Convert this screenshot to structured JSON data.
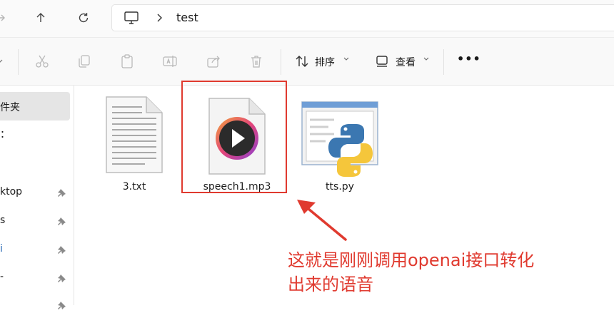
{
  "nav": {
    "forward_icon": "arrow-right-icon",
    "up_icon": "arrow-up-icon",
    "refresh_icon": "refresh-icon"
  },
  "address": {
    "root_icon": "monitor-icon",
    "separator_icon": "chevron-right-icon",
    "path": "test"
  },
  "toolbar": {
    "sort_label": "排序",
    "view_label": "查看",
    "more_label": "•••"
  },
  "sidebar": {
    "items": [
      {
        "label": "件夹",
        "selected": true
      },
      {
        "label": "：",
        "pinned": false
      },
      {
        "label": "ktop",
        "pinned": true
      },
      {
        "label": "s",
        "pinned": true
      },
      {
        "label": "i",
        "pinned": true
      },
      {
        "label": "-",
        "pinned": true
      }
    ]
  },
  "files": [
    {
      "name": "3.txt",
      "icon": "text-file-icon"
    },
    {
      "name": "speech1.mp3",
      "icon": "audio-file-icon",
      "highlighted": true
    },
    {
      "name": "tts.py",
      "icon": "python-file-icon"
    }
  ],
  "annotation": {
    "line1": "这就是刚刚调用openai接口转化",
    "line2": "出来的语音",
    "color": "#e03a2f"
  },
  "colors": {
    "accent_red": "#e03a2f",
    "python_blue": "#3b77b1",
    "python_yellow": "#f5c63b"
  }
}
